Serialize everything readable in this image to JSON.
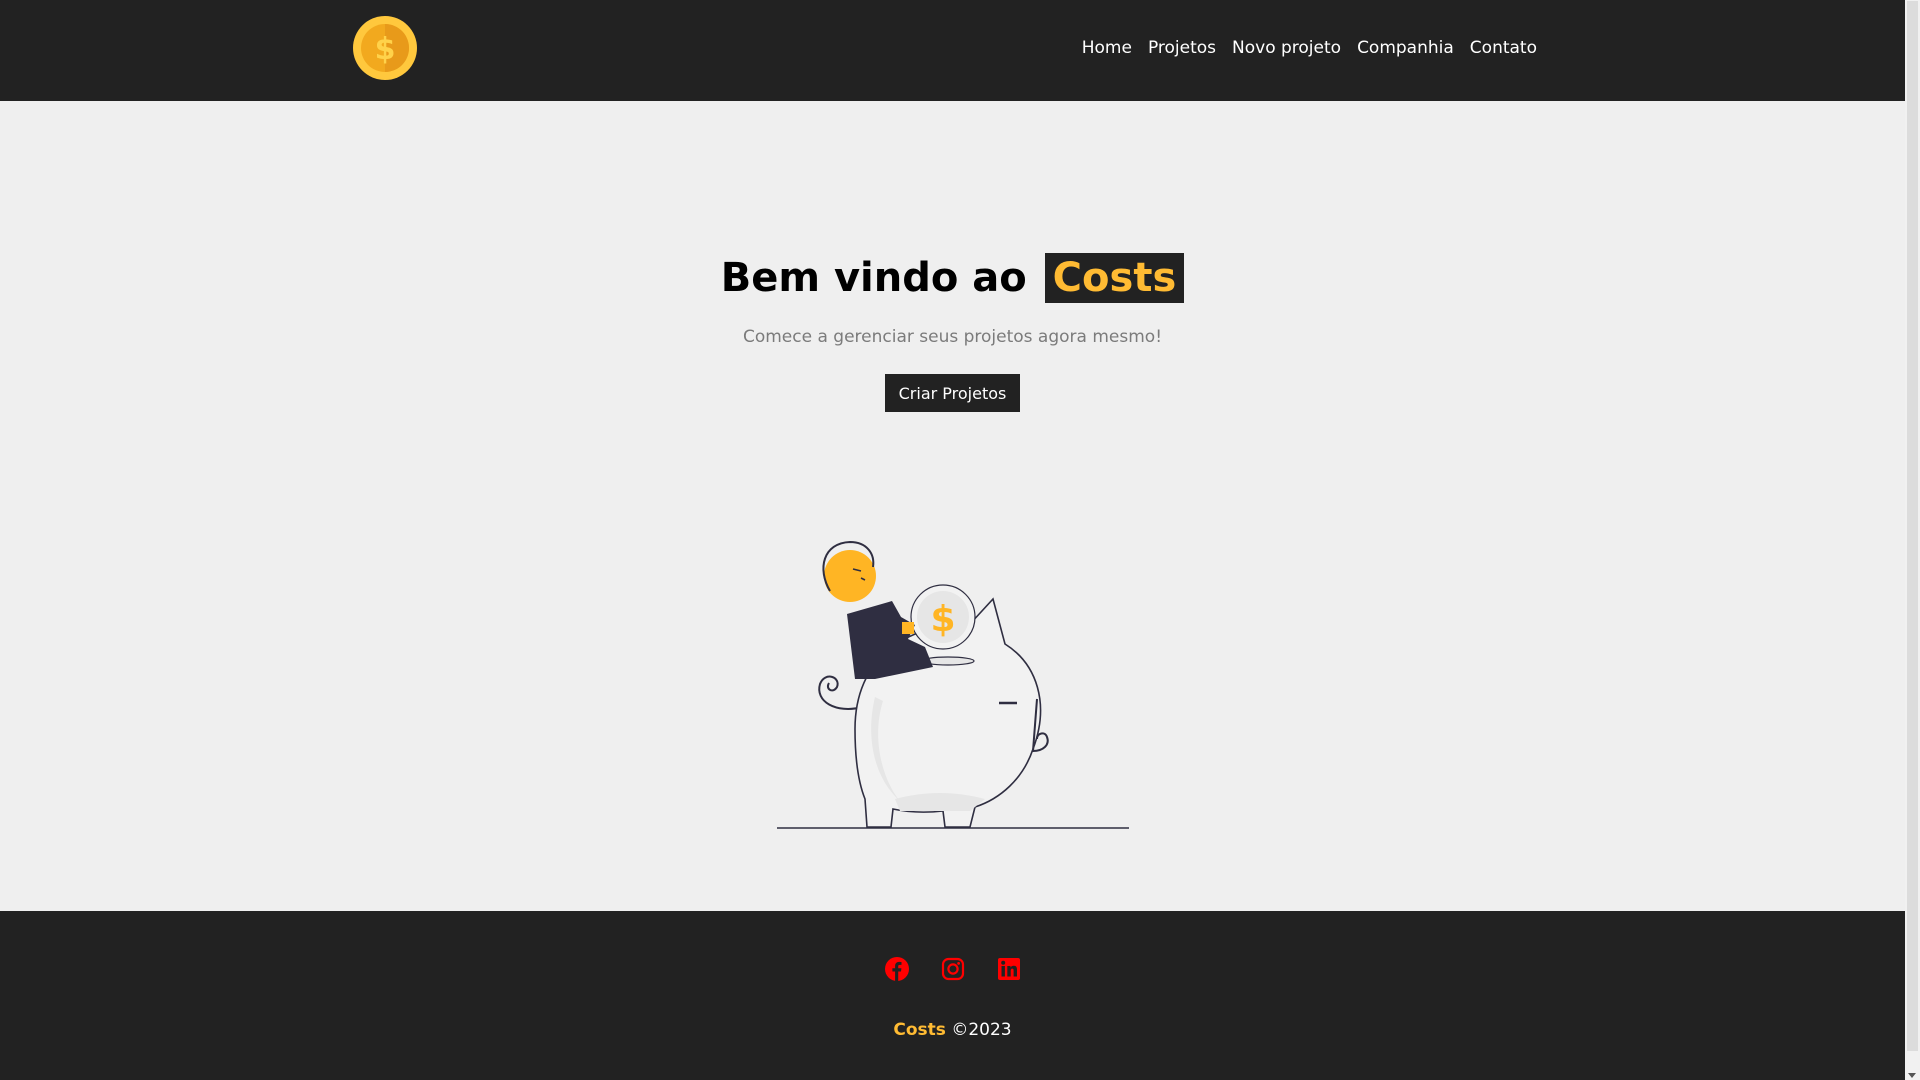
{
  "nav": {
    "logo_icon": "dollar-coin-icon",
    "links": [
      "Home",
      "Projetos",
      "Novo projeto",
      "Companhia",
      "Contato"
    ]
  },
  "hero": {
    "title_prefix": "Bem vindo ao",
    "title_brand": "Costs",
    "subtitle": "Comece a gerenciar seus projetos agora mesmo!",
    "button_label": "Criar Projetos",
    "illustration": "piggy-bank-savings-illustration"
  },
  "footer": {
    "social_icons": [
      "facebook-icon",
      "instagram-icon",
      "linkedin-icon"
    ],
    "brand": "Costs",
    "copyright": "©2023"
  },
  "colors": {
    "dark": "#222222",
    "accent": "#ffbb33",
    "background": "#efefef",
    "social_red": "#ff0000"
  }
}
